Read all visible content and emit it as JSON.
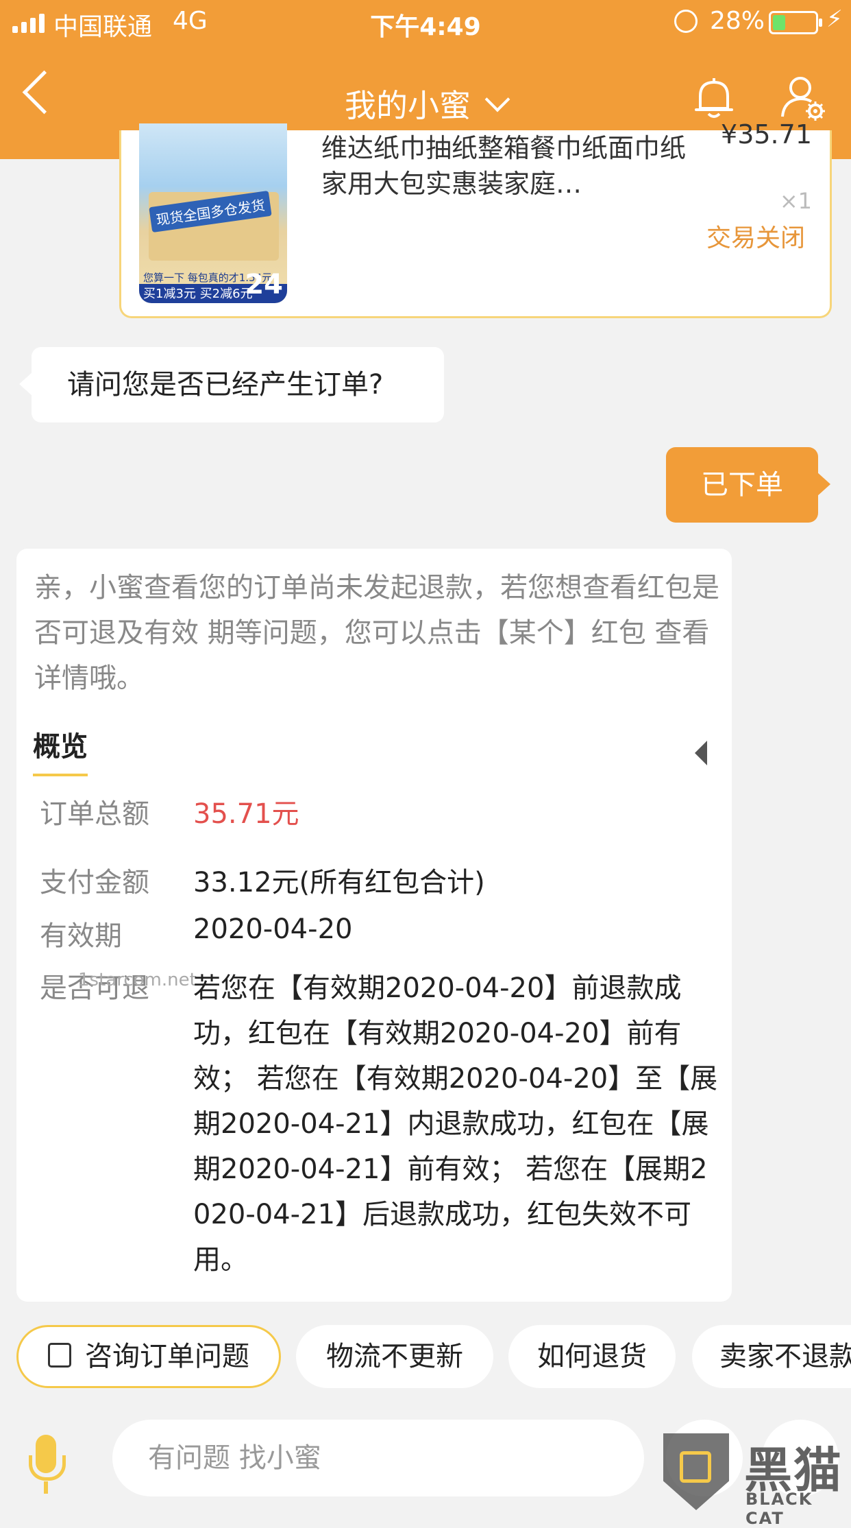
{
  "status_bar": {
    "carrier": "中国联通",
    "network": "4G",
    "time": "下午4:49",
    "battery": "28%",
    "battery_level": 0.28
  },
  "header": {
    "title": "我的小蜜",
    "icons": [
      "back-icon",
      "chevron-down-icon",
      "bell-icon",
      "user-settings-icon"
    ],
    "color": "#f29d38"
  },
  "product_card": {
    "title": "维达纸巾抽纸整箱餐巾纸面巾纸家用大包实惠装家庭…",
    "price": "¥35.71",
    "quantity": "×1",
    "status": "交易关闭",
    "thumb": {
      "banner": "现货全国多仓发货",
      "line1": "您算一下 每包真的才1.54元",
      "line2": "买1减3元 买2减6元",
      "count": "24"
    }
  },
  "messages": {
    "bot_question": "请问您是否已经产生订单?",
    "user_reply": "已下单"
  },
  "info_card": {
    "intro": "亲，小蜜查看您的订单尚未发起退款，若您想查看红包是否可退及有效 期等问题，您可以点击【某个】红包 查看详情哦。",
    "section_title": "概览",
    "rows": [
      {
        "label": "订单总额",
        "value": "35.71元"
      },
      {
        "label": "支付金额",
        "value": "33.12元(所有红包合计)"
      },
      {
        "label": "有效期",
        "value": "2020-04-20"
      },
      {
        "label": "是否可退",
        "value": "若您在【有效期2020-04-20】前退款成功，红包在【有效期2020-04-20】前有效； 若您在【有效期2020-04-20】至【展期2020-04-21】内退款成功，红包在【展期2020-04-21】前有效； 若您在【展期2020-04-21】后退款成功，红包失效不可用。"
      }
    ],
    "watermark": "1starcom.net",
    "accent_color": "#e3504d"
  },
  "quick_chips": [
    "咨询订单问题",
    "物流不更新",
    "如何退货",
    "卖家不退款"
  ],
  "input": {
    "placeholder": "有问题 找小蜜"
  },
  "watermark_logo": {
    "cn": "黑猫",
    "en": "BLACK CAT"
  }
}
